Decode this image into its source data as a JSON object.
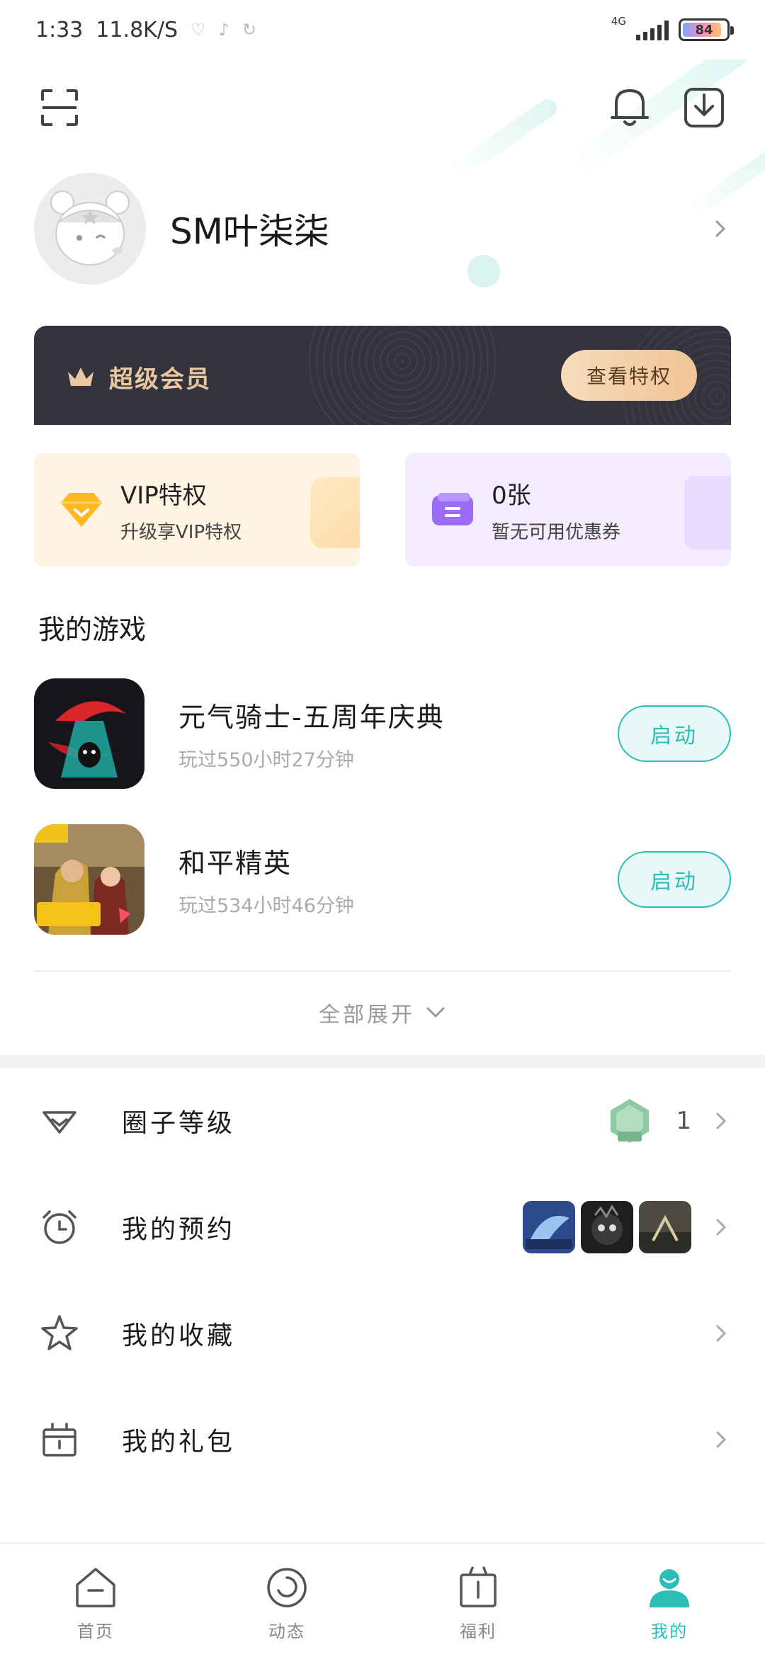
{
  "status_bar": {
    "time": "1:33",
    "speed": "11.8K/S",
    "network": "4G",
    "battery": "84"
  },
  "profile": {
    "username": "SM叶柒柒"
  },
  "vip_banner": {
    "title": "超级会员",
    "button_label": "查看特权"
  },
  "promos": {
    "vip": {
      "title": "VIP特权",
      "subtitle": "升级享VIP特权"
    },
    "coupon": {
      "title": "0张",
      "subtitle": "暂无可用优惠券"
    }
  },
  "my_games": {
    "title": "我的游戏",
    "games": [
      {
        "name": "元气骑士-五周年庆典",
        "playtime": "玩过550小时27分钟",
        "button": "启动"
      },
      {
        "name": "和平精英",
        "playtime": "玩过534小时46分钟",
        "button": "启动"
      }
    ],
    "expand_label": "全部展开"
  },
  "menu": {
    "items": [
      {
        "label": "圈子等级",
        "level": "1"
      },
      {
        "label": "我的预约"
      },
      {
        "label": "我的收藏"
      },
      {
        "label": "我的礼包"
      }
    ]
  },
  "bottom_nav": {
    "items": [
      {
        "label": "首页"
      },
      {
        "label": "动态"
      },
      {
        "label": "福利"
      },
      {
        "label": "我的"
      }
    ],
    "active_color": "#2bbdb8"
  },
  "colors": {
    "accent": "#2bbdb8",
    "vip_dark": "#33333d",
    "vip_gold": "#e9c7a0"
  }
}
